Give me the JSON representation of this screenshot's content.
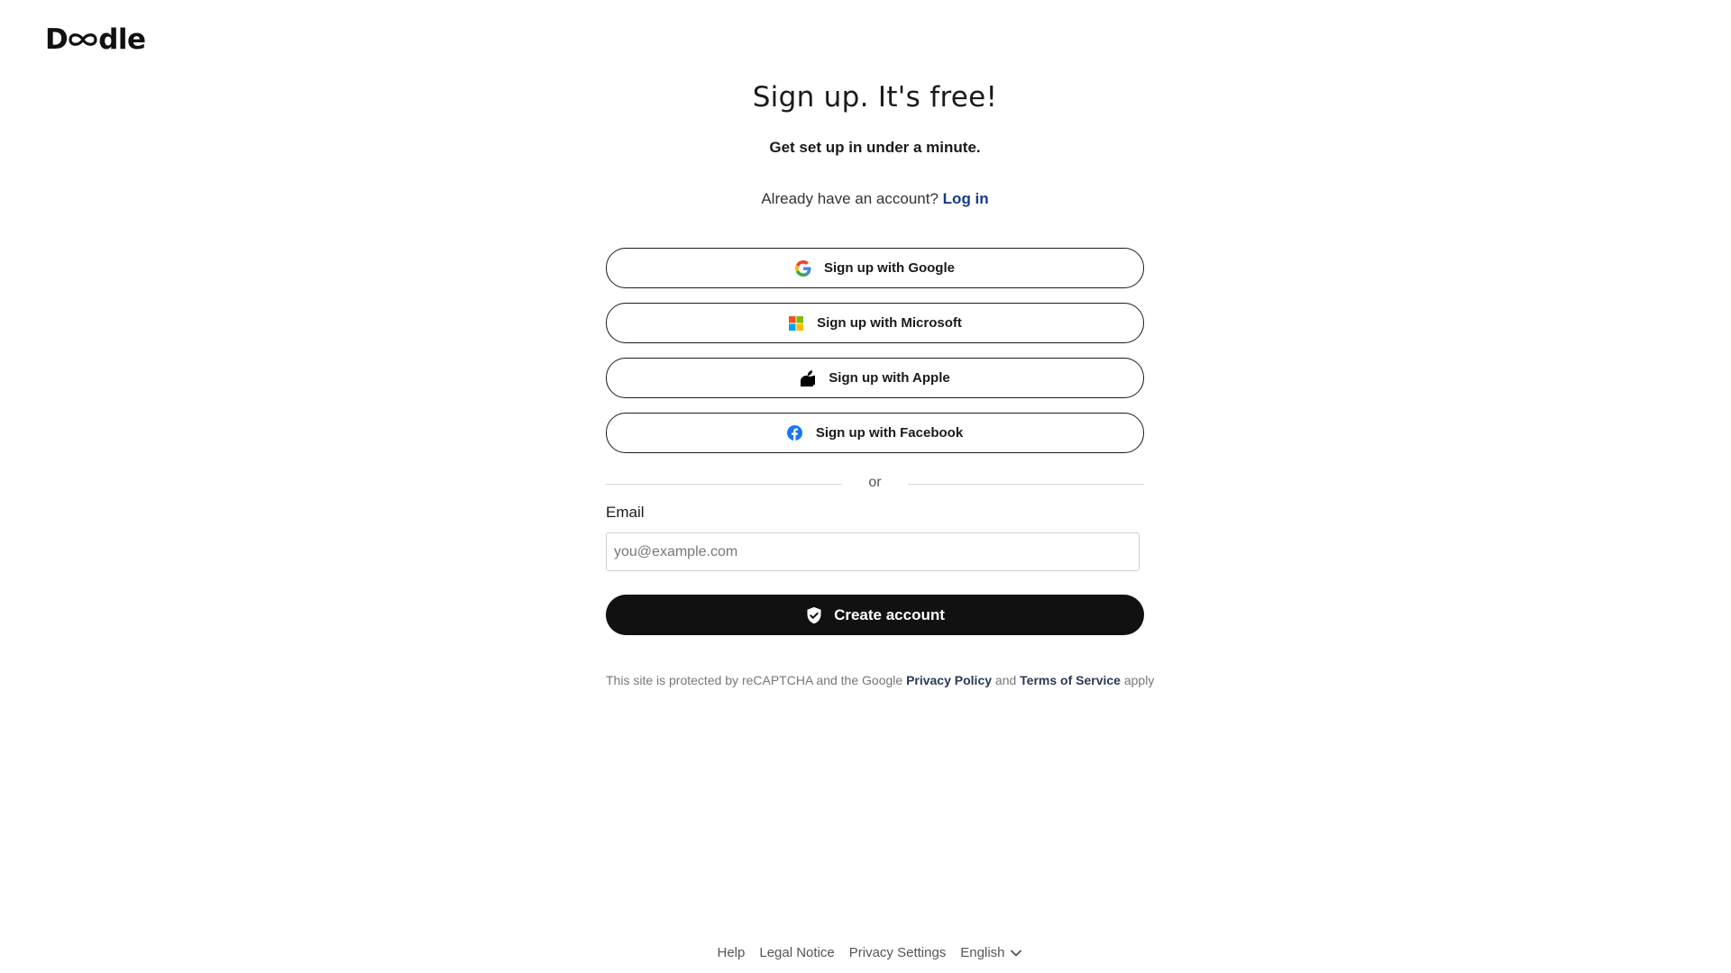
{
  "brand": {
    "logo_text": "Doodle",
    "logo_prefix": "D",
    "logo_suffix": "dle"
  },
  "header": {
    "title": "Sign up. It's free!",
    "subtitle": "Get set up in under a minute.",
    "login_prompt": "Already have an account?",
    "login_link": "Log in"
  },
  "social": {
    "google": {
      "label": "Sign up with Google",
      "icon": "google-icon"
    },
    "microsoft": {
      "label": "Sign up with Microsoft",
      "icon": "microsoft-icon"
    },
    "apple": {
      "label": "Sign up with Apple",
      "icon": "apple-icon"
    },
    "facebook": {
      "label": "Sign up with Facebook",
      "icon": "facebook-icon"
    }
  },
  "divider": {
    "text": "or"
  },
  "form": {
    "email_label": "Email",
    "email_placeholder": "you@example.com",
    "email_value": "",
    "submit_label": "Create account",
    "submit_icon": "shield-check-icon"
  },
  "recaptcha": {
    "text_before": "This site is protected by reCAPTCHA and the Google",
    "privacy_link": "Privacy Policy",
    "and": "and",
    "terms_link": "Terms of Service",
    "text_after": "apply"
  },
  "footer": {
    "links": [
      "Help",
      "Legal Notice",
      "Privacy Settings"
    ],
    "language": "English",
    "language_icon": "chevron-down-icon"
  },
  "colors": {
    "login_link": "#173a8b",
    "primary_button": "#111111",
    "facebook_blue": "#1877f2"
  }
}
